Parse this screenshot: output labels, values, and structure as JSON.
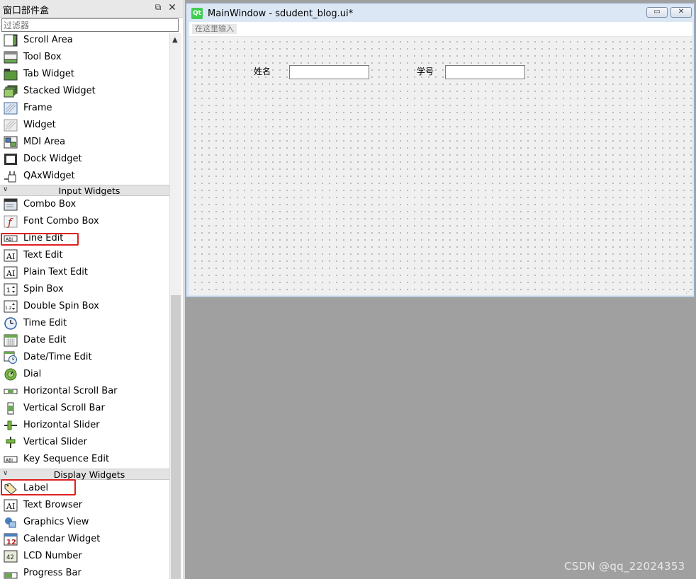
{
  "widget_box": {
    "title": "窗口部件盒",
    "float_icon": "float-icon",
    "close_icon": "close-icon",
    "filter_placeholder": "过滤器",
    "items_top": [
      {
        "label": "Scroll Area",
        "icon": "scroll-area-icon"
      },
      {
        "label": "Tool Box",
        "icon": "tool-box-icon"
      },
      {
        "label": "Tab Widget",
        "icon": "tab-widget-icon"
      },
      {
        "label": "Stacked Widget",
        "icon": "stacked-widget-icon"
      },
      {
        "label": "Frame",
        "icon": "frame-icon"
      },
      {
        "label": "Widget",
        "icon": "widget-icon"
      },
      {
        "label": "MDI Area",
        "icon": "mdi-area-icon"
      },
      {
        "label": "Dock Widget",
        "icon": "dock-widget-icon"
      },
      {
        "label": "QAxWidget",
        "icon": "qaxwidget-icon"
      }
    ],
    "input_category": "Input Widgets",
    "input_items": [
      {
        "label": "Combo Box",
        "icon": "combo-box-icon"
      },
      {
        "label": "Font Combo Box",
        "icon": "font-combo-box-icon"
      },
      {
        "label": "Line Edit",
        "icon": "line-edit-icon"
      },
      {
        "label": "Text Edit",
        "icon": "text-edit-icon"
      },
      {
        "label": "Plain Text Edit",
        "icon": "plain-text-edit-icon"
      },
      {
        "label": "Spin Box",
        "icon": "spin-box-icon"
      },
      {
        "label": "Double Spin Box",
        "icon": "double-spin-box-icon"
      },
      {
        "label": "Time Edit",
        "icon": "time-edit-icon"
      },
      {
        "label": "Date Edit",
        "icon": "date-edit-icon"
      },
      {
        "label": "Date/Time Edit",
        "icon": "date-time-edit-icon"
      },
      {
        "label": "Dial",
        "icon": "dial-icon"
      },
      {
        "label": "Horizontal Scroll Bar",
        "icon": "horizontal-scroll-bar-icon"
      },
      {
        "label": "Vertical Scroll Bar",
        "icon": "vertical-scroll-bar-icon"
      },
      {
        "label": "Horizontal Slider",
        "icon": "horizontal-slider-icon"
      },
      {
        "label": "Vertical Slider",
        "icon": "vertical-slider-icon"
      },
      {
        "label": "Key Sequence Edit",
        "icon": "key-sequence-edit-icon"
      }
    ],
    "display_category": "Display Widgets",
    "display_items": [
      {
        "label": "Label",
        "icon": "label-icon"
      },
      {
        "label": "Text Browser",
        "icon": "text-browser-icon"
      },
      {
        "label": "Graphics View",
        "icon": "graphics-view-icon"
      },
      {
        "label": "Calendar Widget",
        "icon": "calendar-widget-icon"
      },
      {
        "label": "LCD Number",
        "icon": "lcd-number-icon"
      },
      {
        "label": "Progress Bar",
        "icon": "progress-bar-icon"
      }
    ],
    "highlight_color": "#e02020"
  },
  "form_window": {
    "icon_text": "Qt",
    "title": "MainWindow - sdudent_blog.ui*",
    "minimize_icon": "minimize-icon",
    "close_icon": "close-icon",
    "menu_hint": "在这里输入",
    "name_label": "姓名",
    "id_label": "学号"
  },
  "watermark": "CSDN @qq_22024353",
  "colors": {
    "qt_green": "#41cd52",
    "workspace_gray": "#a0a0a0",
    "form_frame": "#dbe7f5"
  }
}
